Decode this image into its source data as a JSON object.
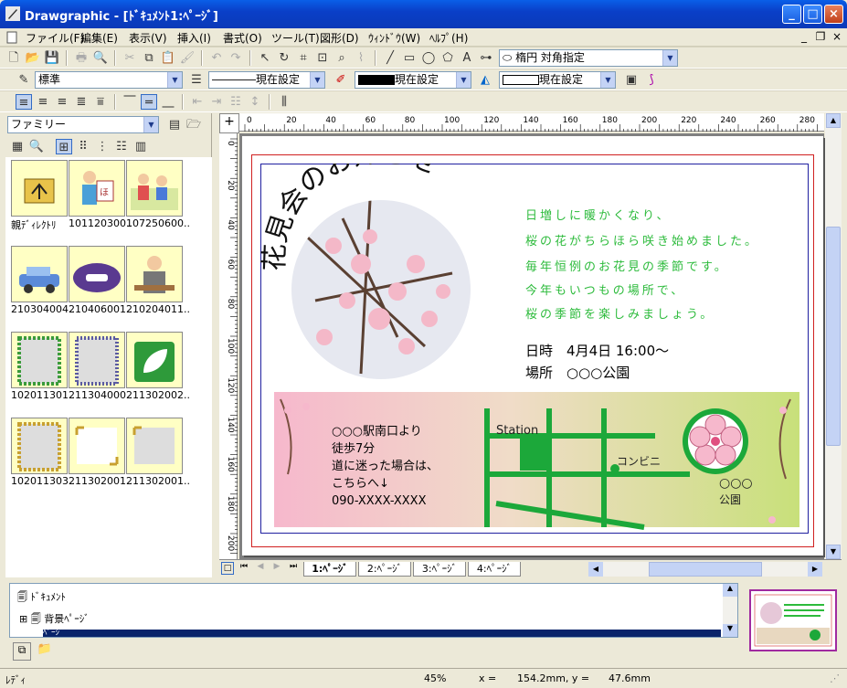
{
  "window": {
    "title": "Drawgraphic - [ﾄﾞｷｭﾒﾝﾄ1:ﾍﾟｰｼﾞ]",
    "minimize": "_",
    "maximize": "□",
    "close": "×"
  },
  "menu": [
    "ファイル(F)",
    "編集(E)",
    "表示(V)",
    "挿入(I)",
    "書式(O)",
    "ツール(T)",
    "図形(D)",
    "ｳｨﾝﾄﾞｳ(W)",
    "ﾍﾙﾌﾟ(H)"
  ],
  "toolbar1": {
    "shape_select": "楕円 対角指定"
  },
  "toolbar2": {
    "style_select": "標準",
    "line_select": "現在設定",
    "line_color_select": "現在設定",
    "fill_color_select": "現在設定"
  },
  "sidebar": {
    "category_select": "ファミリー",
    "items": [
      {
        "label": "親ﾃﾞｨﾚｸﾄﾘ"
      },
      {
        "label": "101120300..."
      },
      {
        "label": "107250600..."
      },
      {
        "label": "210304004..."
      },
      {
        "label": "210406001..."
      },
      {
        "label": "210204011..."
      },
      {
        "label": "102011301..."
      },
      {
        "label": "211304000..."
      },
      {
        "label": "211302002..."
      },
      {
        "label": "102011303..."
      },
      {
        "label": "211302001..."
      },
      {
        "label": "211302001..."
      }
    ]
  },
  "ruler": {
    "h": [
      "0",
      "20",
      "40",
      "60",
      "80",
      "100",
      "120",
      "140",
      "160",
      "180",
      "200",
      "220",
      "240",
      "260",
      "280"
    ],
    "v": [
      "0",
      "20",
      "40",
      "60",
      "80",
      "100",
      "120",
      "140",
      "160",
      "180",
      "200"
    ]
  },
  "card": {
    "title": "花見会のお知らせ",
    "lines": [
      "日増しに暖かくなり、",
      "桜の花がちらほら咲き始めました。",
      "毎年恒例のお花見の季節です。",
      "今年もいつもの場所で、",
      "桜の季節を楽しみましょう。"
    ],
    "datetime_label": "日時",
    "datetime_value": "4月4日 16:00～",
    "place_label": "場所",
    "place_value": "○○○公園",
    "directions": [
      "○○○駅南口より",
      "徒歩7分",
      "道に迷った場合は、",
      "こちらへ↓",
      "090-XXXX-XXXX"
    ],
    "map_station": "Station",
    "map_conv": "コンビニ",
    "map_park1": "○○○",
    "map_park2": "公園"
  },
  "pagetabs": [
    "1:ﾍﾟｰｼﾞ",
    "2:ﾍﾟｰｼﾞ",
    "3:ﾍﾟｰｼﾞ",
    "4:ﾍﾟｰｼﾞ"
  ],
  "tree": {
    "root": "ﾄﾞｷｭﾒﾝﾄ",
    "bg": "背景ﾍﾟｰｼﾞ",
    "page": "ﾍﾟｰｼﾞ"
  },
  "status": {
    "ready": "ﾚﾃﾞｨ",
    "zoom": "45%",
    "x_label": "x =",
    "x_value": "154.2mm, y =",
    "y_value": "47.6mm"
  },
  "colors": {
    "green": "#2dbb3c",
    "title_blue": "#0a3fc8"
  }
}
